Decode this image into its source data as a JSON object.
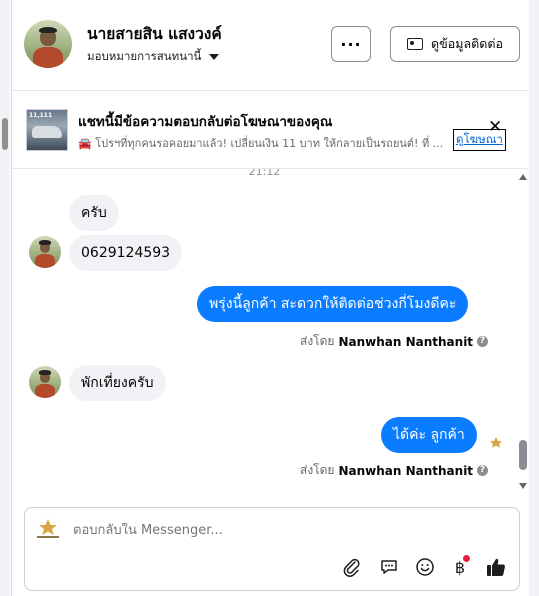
{
  "header": {
    "name": "นายสายสิน แสงวงค์",
    "assign_label": "มอบหมายการสนทนานี้",
    "more_label": "···",
    "contact_label": "ดูข้อมูลติดต่อ"
  },
  "ad": {
    "thumb_text": "11,111",
    "title": "แชทนี้มีข้อความตอบกลับต่อโฆษณาของคุณ",
    "text": "🚘 โปรฯที่ทุกคนรอคอยมาแล้ว! เปลี่ยนเงิน 11 บาท ให้กลายเป็นรถยนต์! ที่ ...",
    "link_label": "ดูโฆษณา",
    "close_label": "✕"
  },
  "chat": {
    "timestamp": "21:12",
    "messages": [
      {
        "from": "customer",
        "text": "ครับ"
      },
      {
        "from": "customer",
        "text": "0629124593"
      },
      {
        "from": "page",
        "text": "พรุ่งนี้ลูกค้า สะดวกให้ติดต่อช่วงกี่โมงดีคะ"
      },
      {
        "from": "customer",
        "text": "พักเที่ยงครับ"
      },
      {
        "from": "page",
        "text": "ได้ค่ะ  ลูกค้า"
      }
    ],
    "sent_by_prefix": "ส่งโดย",
    "sent_by_name": "Nanwhan Nanthanit",
    "info_symbol": "?"
  },
  "composer": {
    "placeholder": "ตอบกลับใน Messenger...",
    "baht_symbol": "฿"
  },
  "colors": {
    "outgoing_bubble": "#0a7cff",
    "incoming_bubble": "#f0f2f5",
    "link": "#0064d1",
    "like": "#1c1e21",
    "notification_dot": "#e41e3f"
  }
}
